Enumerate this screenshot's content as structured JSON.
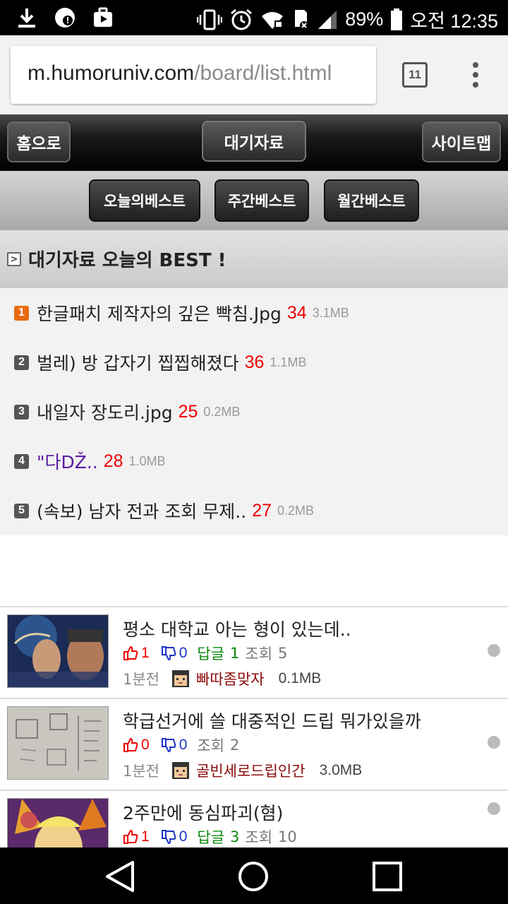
{
  "status": {
    "battery": "89%",
    "time": "오전 12:35"
  },
  "browser": {
    "url_host": "m.humoruniv.com",
    "url_path": "/board/list.html",
    "tab_count": "11"
  },
  "nav": {
    "home": "홈으로",
    "center": "대기자료",
    "sitemap": "사이트맵"
  },
  "subnav": {
    "today": "오늘의베스트",
    "week": "주간베스트",
    "month": "월간베스트"
  },
  "best": {
    "heading": "대기자료 오늘의 BEST !",
    "items": [
      {
        "rank": "1",
        "title": "한글패치 제작자의 깊은 빡침.Jpg",
        "count": "34",
        "size": "3.1MB"
      },
      {
        "rank": "2",
        "title": "벌레) 방 갑자기 찝찝해졌다",
        "count": "36",
        "size": "1.1MB"
      },
      {
        "rank": "3",
        "title": "내일자 장도리.jpg",
        "count": "25",
        "size": "0.2MB"
      },
      {
        "rank": "4",
        "title": "\"다DŽ..",
        "count": "28",
        "size": "1.0MB"
      },
      {
        "rank": "5",
        "title": "(속보) 남자 전과 조회 무제..",
        "count": "27",
        "size": "0.2MB"
      }
    ]
  },
  "posts": [
    {
      "title": "평소 대학교 아는 형이 있는데..",
      "up": "1",
      "down": "0",
      "reply_label": "답글",
      "reply": "1",
      "views_label": "조회",
      "views": "5",
      "time": "1분전",
      "author": "빠따좀맞자",
      "size": "0.1MB"
    },
    {
      "title": "학급선거에 쓸 대중적인 드립 뭐가있을까",
      "up": "0",
      "down": "0",
      "views_label": "조회",
      "views": "2",
      "time": "1분전",
      "author": "골빈세로드립인간",
      "size": "3.0MB"
    },
    {
      "title": "2주만에 동심파괴(혐)",
      "up": "1",
      "down": "0",
      "reply_label": "답글",
      "reply": "3",
      "views_label": "조회",
      "views": "10"
    }
  ]
}
